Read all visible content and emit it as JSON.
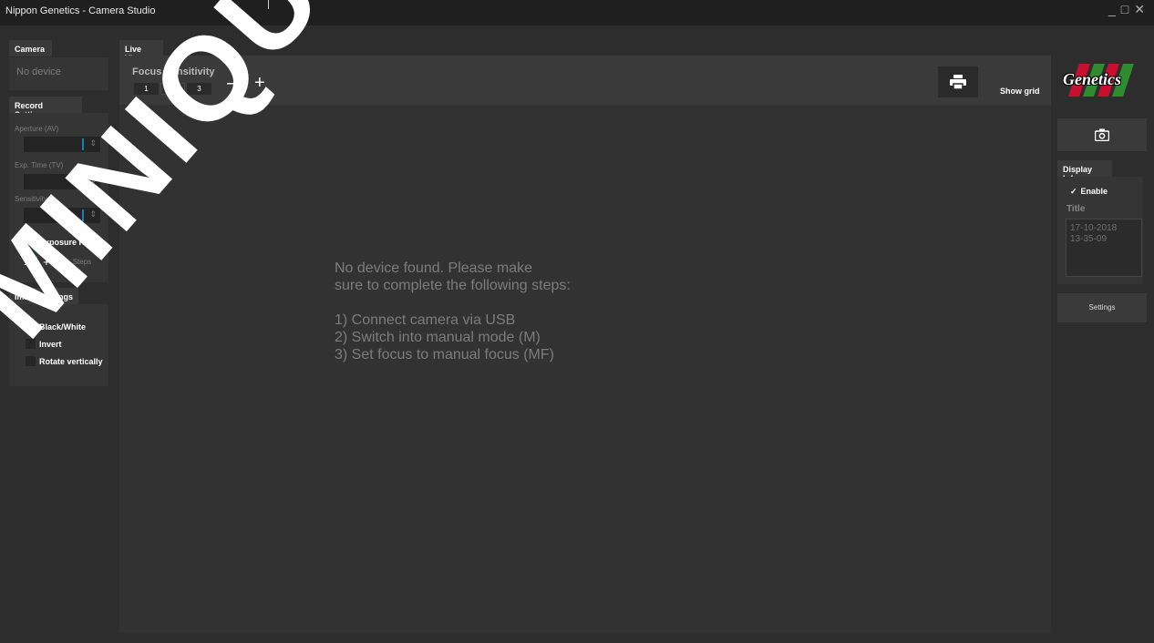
{
  "window": {
    "title": "Nippon Genetics - Camera Studio",
    "controls": [
      "_",
      "□",
      "✕"
    ]
  },
  "sidebar": {
    "camera_tab": "Camera",
    "camera_status": "No device",
    "record_tab": "Record Settings",
    "aperture_label": "Aperture (AV)",
    "exp_time_label": "Exp. Time (TV)",
    "sensitivity_label": "Sensitivity",
    "exposure_range_label": "Exposure Range",
    "steps_value": "1",
    "steps_plus": "+",
    "steps_minus": "—",
    "steps_label": "Steps",
    "image_tab": "Image Settings",
    "black_white_label": "Black/White",
    "invert_label": "Invert",
    "rotate_label": "Rotate vertically"
  },
  "liveview": {
    "tab": "Live View",
    "focus_title": "Focus Sensitivity",
    "focus_options": [
      "1",
      "2",
      "3"
    ],
    "focus_selected": "2",
    "minus": "—",
    "plus": "+",
    "show_grid": "Show grid",
    "message": "No device found. Please make\nsure to complete the following steps:\n\n1) Connect camera via USB\n2) Switch into manual mode (M)\n3) Set focus to manual focus (MF)"
  },
  "right_panel": {
    "logo_text": "Genetics",
    "display_info_tab": "Display Info",
    "enable_label": "Enable",
    "enable_check": "✓",
    "title_label": "Title",
    "date": "17-10-2018",
    "time": "13-35-09",
    "settings_label": "Settings"
  },
  "watermark": "MINIQUE DU",
  "colors": {
    "background": "#2d2d2d",
    "panel": "#353535",
    "titlebar": "#1f1f1f",
    "accent_caret": "#1a7fb0",
    "logo_red": "#c8102e",
    "logo_green": "#2e8b2e"
  }
}
